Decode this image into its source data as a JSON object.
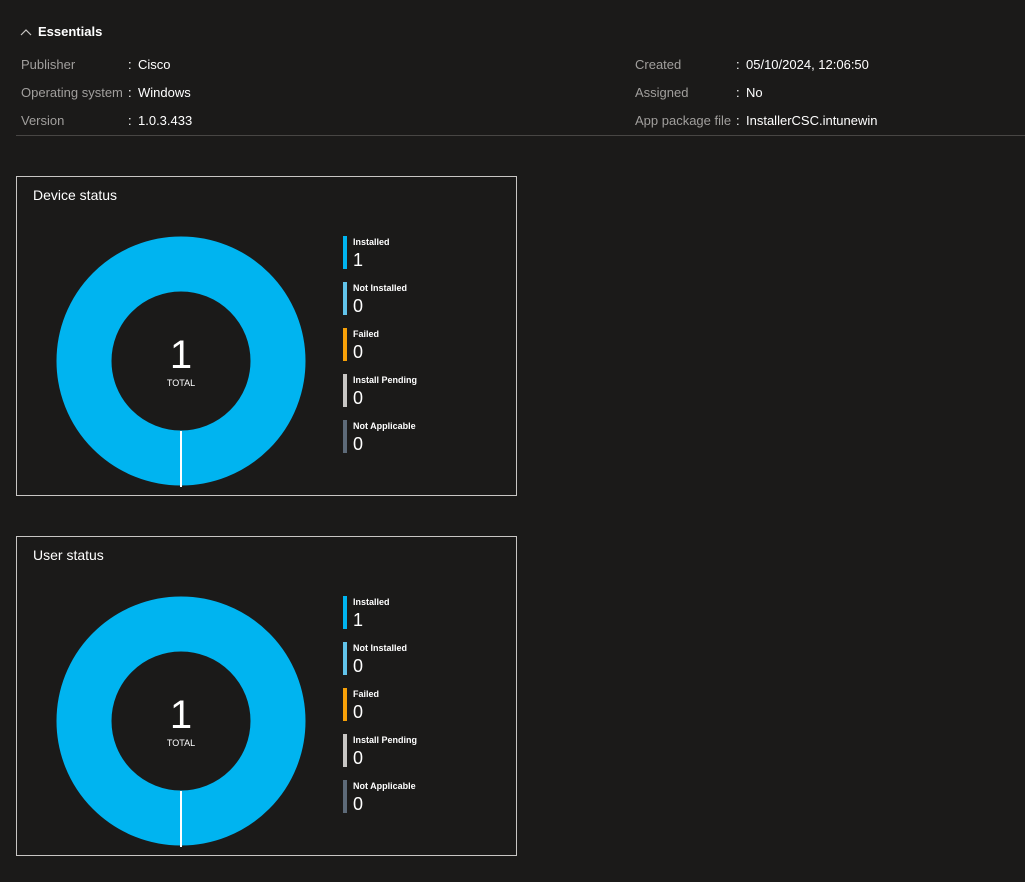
{
  "essentials": {
    "title": "Essentials",
    "left": [
      {
        "label": "Publisher",
        "value": "Cisco"
      },
      {
        "label": "Operating system",
        "value": "Windows"
      },
      {
        "label": "Version",
        "value": "1.0.3.433"
      }
    ],
    "right": [
      {
        "label": "Created",
        "value": "05/10/2024, 12:06:50"
      },
      {
        "label": "Assigned",
        "value": "No"
      },
      {
        "label": "App package file",
        "value": "InstallerCSC.intunewin"
      }
    ],
    "colon": ":"
  },
  "colors": {
    "installed": "#00b4f0",
    "not_installed": "#61c3ea",
    "failed": "#f7a008",
    "install_pending": "#c8c6c4",
    "not_applicable": "#5d6a78"
  },
  "device_status": {
    "title": "Device status",
    "total": "1",
    "total_label": "TOTAL",
    "legend": [
      {
        "label": "Installed",
        "value": "1"
      },
      {
        "label": "Not Installed",
        "value": "0"
      },
      {
        "label": "Failed",
        "value": "0"
      },
      {
        "label": "Install Pending",
        "value": "0"
      },
      {
        "label": "Not Applicable",
        "value": "0"
      }
    ]
  },
  "user_status": {
    "title": "User status",
    "total": "1",
    "total_label": "TOTAL",
    "legend": [
      {
        "label": "Installed",
        "value": "1"
      },
      {
        "label": "Not Installed",
        "value": "0"
      },
      {
        "label": "Failed",
        "value": "0"
      },
      {
        "label": "Install Pending",
        "value": "0"
      },
      {
        "label": "Not Applicable",
        "value": "0"
      }
    ]
  }
}
